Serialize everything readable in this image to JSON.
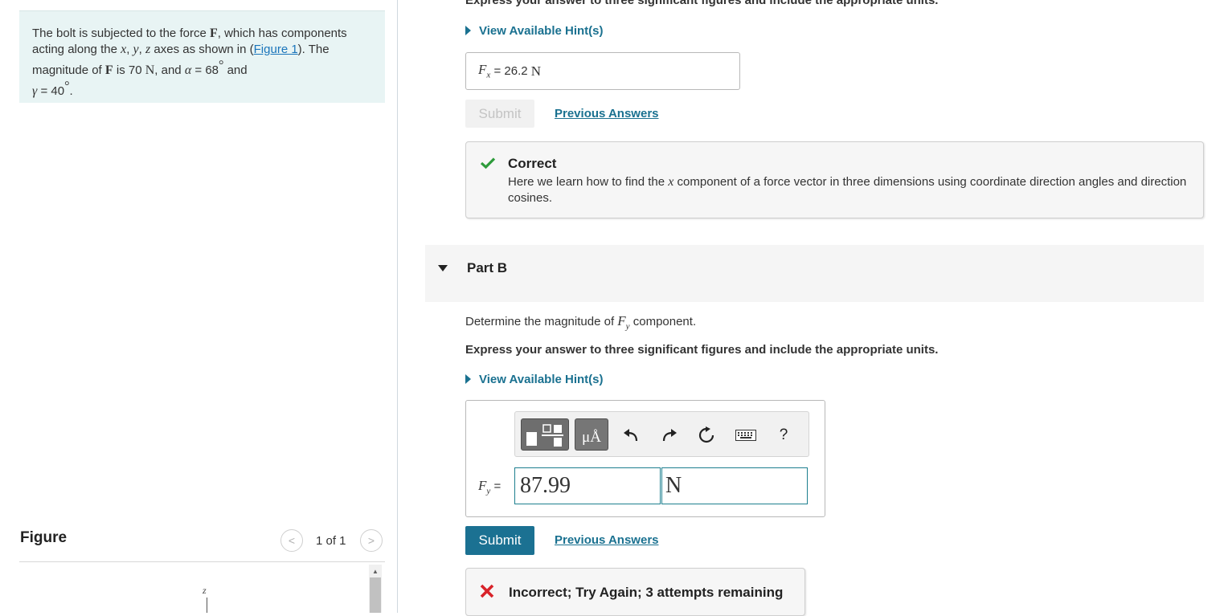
{
  "problem": {
    "t1": "The bolt is subjected to the force ",
    "F": "F",
    "t2": ", which has components acting along the ",
    "x": "x",
    "c1": ", ",
    "y": "y",
    "c2": ", ",
    "z": "z",
    "t3": " axes as shown in (",
    "figure_link": "Figure 1",
    "t4": "). The magnitude of ",
    "t5": " is 70 ",
    "N": "N",
    "t6": ", and ",
    "alpha": "α",
    "t7": " = 68",
    "deg": "°",
    "t8": " and ",
    "gamma": "γ",
    "t9": " = 40",
    "t10": "."
  },
  "figure": {
    "label": "Figure",
    "prev": "<",
    "count": "1 of 1",
    "next": ">",
    "axis_label": "z"
  },
  "part_a": {
    "top_instruction": "Express your answer to three significant figures and include the appropriate units.",
    "hints_label": "View Available Hint(s)",
    "answer_var": "F",
    "answer_sub": "x",
    "answer_eq": " = ",
    "answer_value": "26.2",
    "answer_unit": "N",
    "submit_label": "Submit",
    "previous_answers_label": "Previous Answers",
    "feedback_title": "Correct",
    "feedback_text": "Here we learn how to find the ",
    "feedback_var": "x",
    "feedback_text2": " component of a force vector in three dimensions using coordinate direction angles and direction cosines."
  },
  "part_b": {
    "title": "Part B",
    "question_pre": "Determine the magnitude of ",
    "question_var": "F",
    "question_sub": "y",
    "question_post": " component.",
    "instruction": "Express your answer to three significant figures and include the appropriate units.",
    "hints_label": "View Available Hint(s)",
    "toolbar": {
      "units_label": "μÅ",
      "help_label": "?"
    },
    "input_var": "F",
    "input_sub": "y",
    "input_eq": " =",
    "input_value": "87.99",
    "unit_value": "N",
    "submit_label": "Submit",
    "previous_answers_label": "Previous Answers",
    "feedback_text": "Incorrect; Try Again; 3 attempts remaining"
  },
  "colors": {
    "accent": "#1b7192",
    "link": "#1b75bb",
    "correct": "#2e9b3b",
    "incorrect": "#d8232a",
    "problem_bg": "#e8f4f4"
  },
  "icons": [
    "template-icon",
    "units-icon",
    "undo-icon",
    "redo-icon",
    "reset-icon",
    "keyboard-icon",
    "help-icon",
    "check-icon",
    "x-icon",
    "caret-down-icon",
    "hint-triangle-icon"
  ]
}
